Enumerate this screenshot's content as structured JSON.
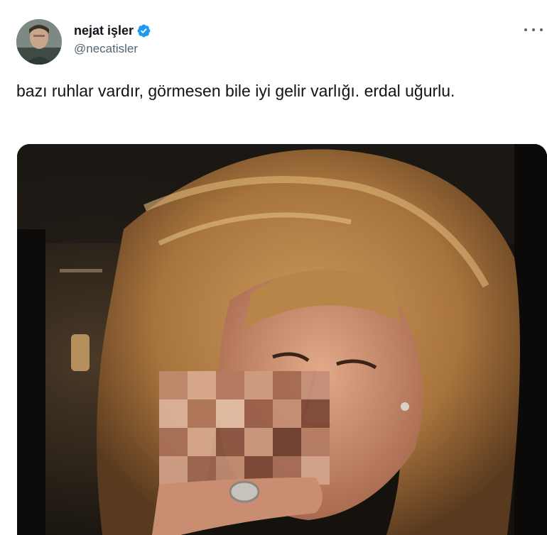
{
  "tweet": {
    "author": {
      "display_name": "nejat işler",
      "handle": "@necatisler",
      "verified": true,
      "avatar_icon": "profile-photo"
    },
    "text": "bazı ruhlar vardır, görmesen bile iyi gelir varlığı. erdal uğurlu.",
    "more_icon": "more-horizontal-icon",
    "media": {
      "type": "photo",
      "pixelated_region": true
    }
  },
  "colors": {
    "text_primary": "#0f1419",
    "text_secondary": "#536471",
    "verified_blue": "#1d9bf0"
  }
}
